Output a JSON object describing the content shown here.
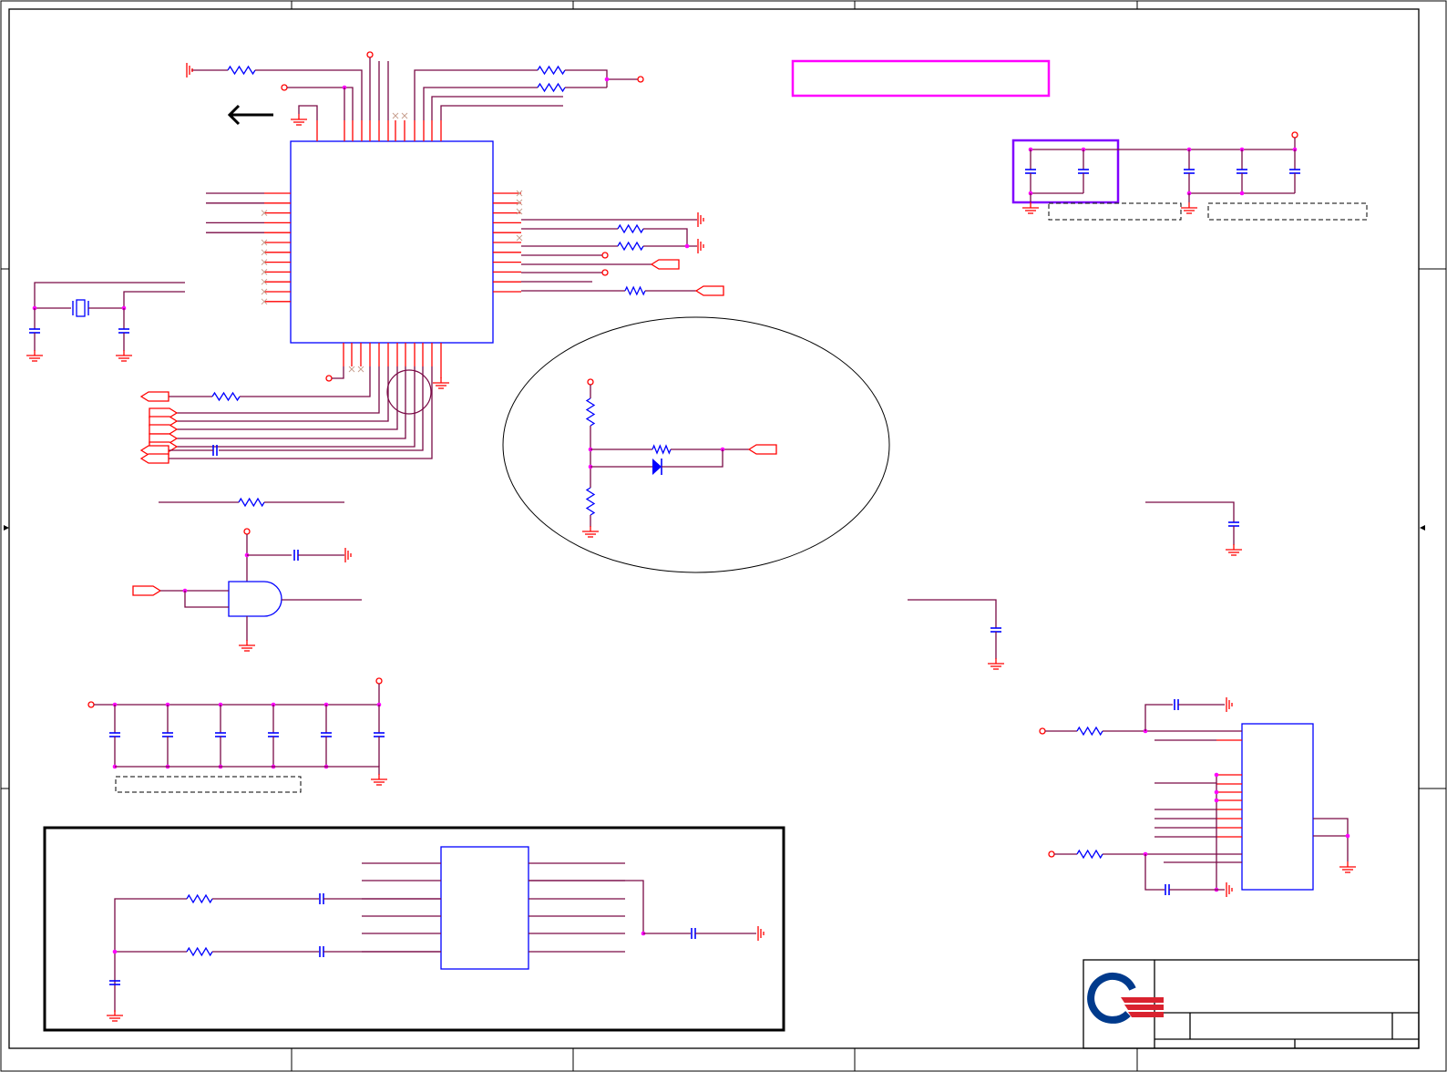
{
  "diagram": {
    "type": "electronic-schematic",
    "colors": {
      "wire": "#7a0a46",
      "pin": "#ff0000",
      "component": "#0000ff",
      "junction": "#ff00ff",
      "highlight_box": "#ff00ff",
      "group_box": "#8000ff",
      "frame": "#000000"
    },
    "title_block": {
      "logo": "company-logo",
      "logo_colors": {
        "ring": "#003a8c",
        "bars": "#d9222f"
      }
    }
  }
}
